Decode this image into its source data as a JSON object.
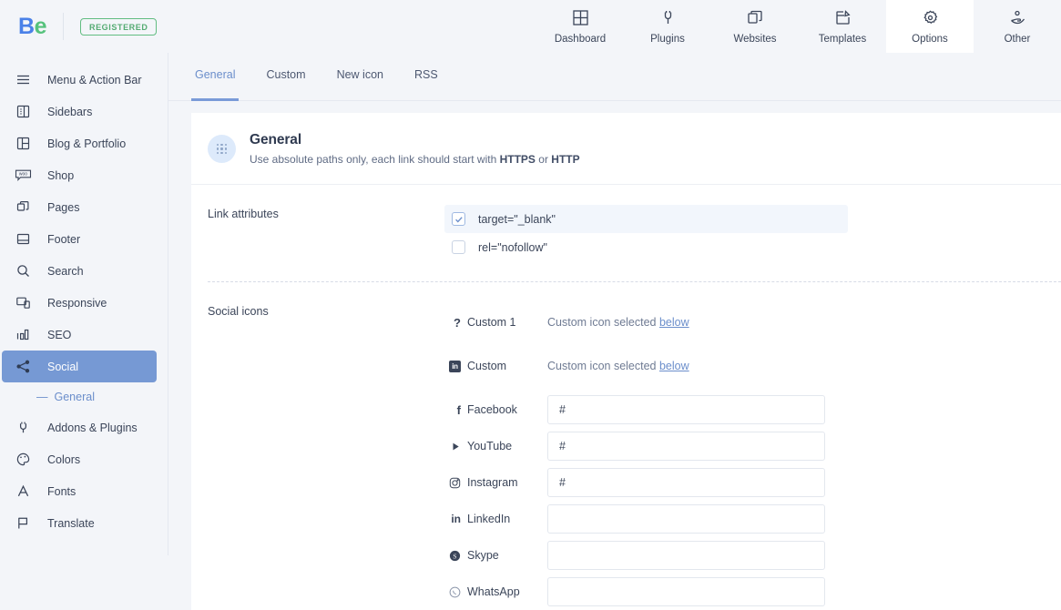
{
  "brand": {
    "logo_b": "B",
    "logo_e": "e",
    "badge": "REGISTERED"
  },
  "topnav": {
    "items": [
      {
        "label": "Dashboard",
        "icon": "grid-icon",
        "active": false
      },
      {
        "label": "Plugins",
        "icon": "plug-icon",
        "active": false
      },
      {
        "label": "Websites",
        "icon": "layers-icon",
        "active": false
      },
      {
        "label": "Templates",
        "icon": "template-edit-icon",
        "active": false
      },
      {
        "label": "Options",
        "icon": "gear-icon",
        "active": true
      },
      {
        "label": "Other",
        "icon": "hand-icon",
        "active": false
      }
    ]
  },
  "sidebar": {
    "items": [
      {
        "label": "Menu & Action Bar",
        "icon": "hamburger-icon"
      },
      {
        "label": "Sidebars",
        "icon": "sidebar-icon"
      },
      {
        "label": "Blog & Portfolio",
        "icon": "columns-icon"
      },
      {
        "label": "Shop",
        "icon": "woo-icon"
      },
      {
        "label": "Pages",
        "icon": "pages-icon"
      },
      {
        "label": "Footer",
        "icon": "footer-icon"
      },
      {
        "label": "Search",
        "icon": "search-icon"
      },
      {
        "label": "Responsive",
        "icon": "responsive-icon"
      },
      {
        "label": "SEO",
        "icon": "bar-chart-icon"
      },
      {
        "label": "Social",
        "icon": "share-icon",
        "active": true
      },
      {
        "label": "Addons & Plugins",
        "icon": "plug-icon"
      },
      {
        "label": "Colors",
        "icon": "palette-icon"
      },
      {
        "label": "Fonts",
        "icon": "font-icon"
      },
      {
        "label": "Translate",
        "icon": "flag-icon"
      }
    ],
    "sub_item": {
      "dash": "—",
      "label": "General"
    }
  },
  "tabs": [
    {
      "label": "General",
      "active": true
    },
    {
      "label": "Custom",
      "active": false
    },
    {
      "label": "New icon",
      "active": false
    },
    {
      "label": "RSS",
      "active": false
    }
  ],
  "panel": {
    "title": "General",
    "desc_pre": "Use absolute paths only, each link should start with ",
    "desc_https": "HTTPS",
    "desc_or": " or ",
    "desc_http": "HTTP",
    "icon": "dots-grid-icon"
  },
  "link_attributes": {
    "label": "Link attributes",
    "options": [
      {
        "label": "target=\"_blank\"",
        "checked": true
      },
      {
        "label": "rel=\"nofollow\"",
        "checked": false
      }
    ]
  },
  "social_icons": {
    "label": "Social icons",
    "note_text": "Custom icon selected ",
    "note_link": "below",
    "rows": [
      {
        "name": "Custom 1",
        "icon": "question-mark-icon",
        "type": "note"
      },
      {
        "name": "Custom",
        "icon": "linkedin-icon",
        "type": "note"
      },
      {
        "name": "Facebook",
        "icon": "facebook-icon",
        "type": "input",
        "value": "#"
      },
      {
        "name": "YouTube",
        "icon": "youtube-icon",
        "type": "input",
        "value": "#"
      },
      {
        "name": "Instagram",
        "icon": "instagram-icon",
        "type": "input",
        "value": "#"
      },
      {
        "name": "LinkedIn",
        "icon": "linkedin-icon",
        "type": "input",
        "value": ""
      },
      {
        "name": "Skype",
        "icon": "skype-icon",
        "type": "input",
        "value": ""
      },
      {
        "name": "WhatsApp",
        "icon": "whatsapp-icon",
        "type": "input",
        "value": ""
      }
    ]
  },
  "colors": {
    "accent_blue": "#6b8ecb",
    "sidebar_active": "#7699d4",
    "brand_blue": "#4a81e8",
    "brand_green": "#55c27c",
    "badge_green": "#62bd82",
    "page_bg": "#f3f5f9"
  }
}
